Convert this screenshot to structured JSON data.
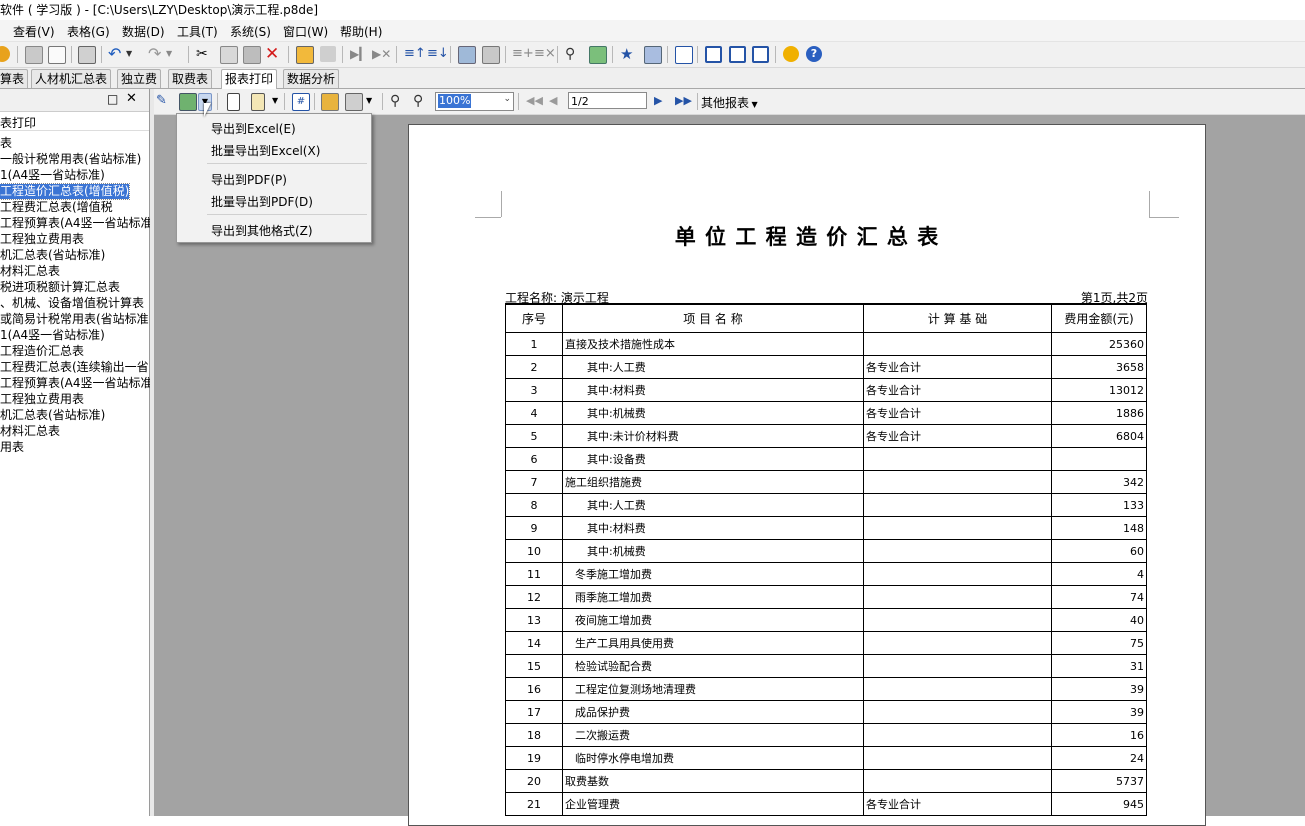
{
  "window": {
    "title": "软件 ( 学习版 ) - [C:\\Users\\LZY\\Desktop\\演示工程.p8de]"
  },
  "menubar": {
    "items": [
      "查看(V)",
      "表格(G)",
      "数据(D)",
      "工具(T)",
      "系统(S)",
      "窗口(W)",
      "帮助(H)"
    ]
  },
  "tabs": {
    "items": [
      "算表",
      "人材机汇总表",
      "独立费",
      "取费表",
      "报表打印",
      "数据分析"
    ],
    "active": "报表打印"
  },
  "left_panel": {
    "header": "表打印",
    "tree": [
      "表",
      "一般计税常用表(省站标准)",
      "1(A4竖一省站标准)",
      "工程造价汇总表(增值税)",
      "工程费汇总表(增值税",
      "工程预算表(A4竖一省站标准",
      "工程独立费用表",
      "机汇总表(省站标准)",
      "材料汇总表",
      "税进项税额计算汇总表",
      "、机械、设备增值税计算表",
      "或简易计税常用表(省站标准",
      "1(A4竖一省站标准)",
      "工程造价汇总表",
      "工程费汇总表(连续输出一省",
      "工程预算表(A4竖一省站标准",
      "工程独立费用表",
      "机汇总表(省站标准)",
      "材料汇总表",
      "用表"
    ],
    "selected_index": 3
  },
  "report_toolbar": {
    "zoom": "100%",
    "page_input": "1/2",
    "other_reports": "其他报表"
  },
  "export_menu": {
    "items": [
      "导出到Excel(E)",
      "批量导出到Excel(X)",
      "导出到PDF(P)",
      "批量导出到PDF(D)",
      "导出到其他格式(Z)"
    ]
  },
  "report": {
    "title": "单 位 工 程 造 价 汇 总 表",
    "project_label": "工程名称: 演示工程",
    "page_info": "第1页,共2页",
    "headers": [
      "序号",
      "项 目 名 称",
      "计 算 基 础",
      "费用金额(元)"
    ],
    "rows": [
      [
        "1",
        "直接及技术措施性成本",
        "",
        "25360"
      ],
      [
        "2",
        "其中:人工费",
        "各专业合计",
        "3658"
      ],
      [
        "3",
        "其中:材料费",
        "各专业合计",
        "13012"
      ],
      [
        "4",
        "其中:机械费",
        "各专业合计",
        "1886"
      ],
      [
        "5",
        "其中:未计价材料费",
        "各专业合计",
        "6804"
      ],
      [
        "6",
        "其中:设备费",
        "",
        ""
      ],
      [
        "7",
        "施工组织措施费",
        "",
        "342"
      ],
      [
        "8",
        "其中:人工费",
        "",
        "133"
      ],
      [
        "9",
        "其中:材料费",
        "",
        "148"
      ],
      [
        "10",
        "其中:机械费",
        "",
        "60"
      ],
      [
        "11",
        "冬季施工增加费",
        "",
        "4"
      ],
      [
        "12",
        "雨季施工增加费",
        "",
        "74"
      ],
      [
        "13",
        "夜间施工增加费",
        "",
        "40"
      ],
      [
        "14",
        "生产工具用具使用费",
        "",
        "75"
      ],
      [
        "15",
        "检验试验配合费",
        "",
        "31"
      ],
      [
        "16",
        "工程定位复测场地清理费",
        "",
        "39"
      ],
      [
        "17",
        "成品保护费",
        "",
        "39"
      ],
      [
        "18",
        "二次搬运费",
        "",
        "16"
      ],
      [
        "19",
        "临时停水停电增加费",
        "",
        "24"
      ],
      [
        "20",
        "取费基数",
        "",
        "5737"
      ],
      [
        "21",
        "企业管理费",
        "各专业合计",
        "945"
      ]
    ]
  },
  "colors": {
    "selection": "#3a74d4",
    "preview_bg": "#a3a3a3"
  }
}
